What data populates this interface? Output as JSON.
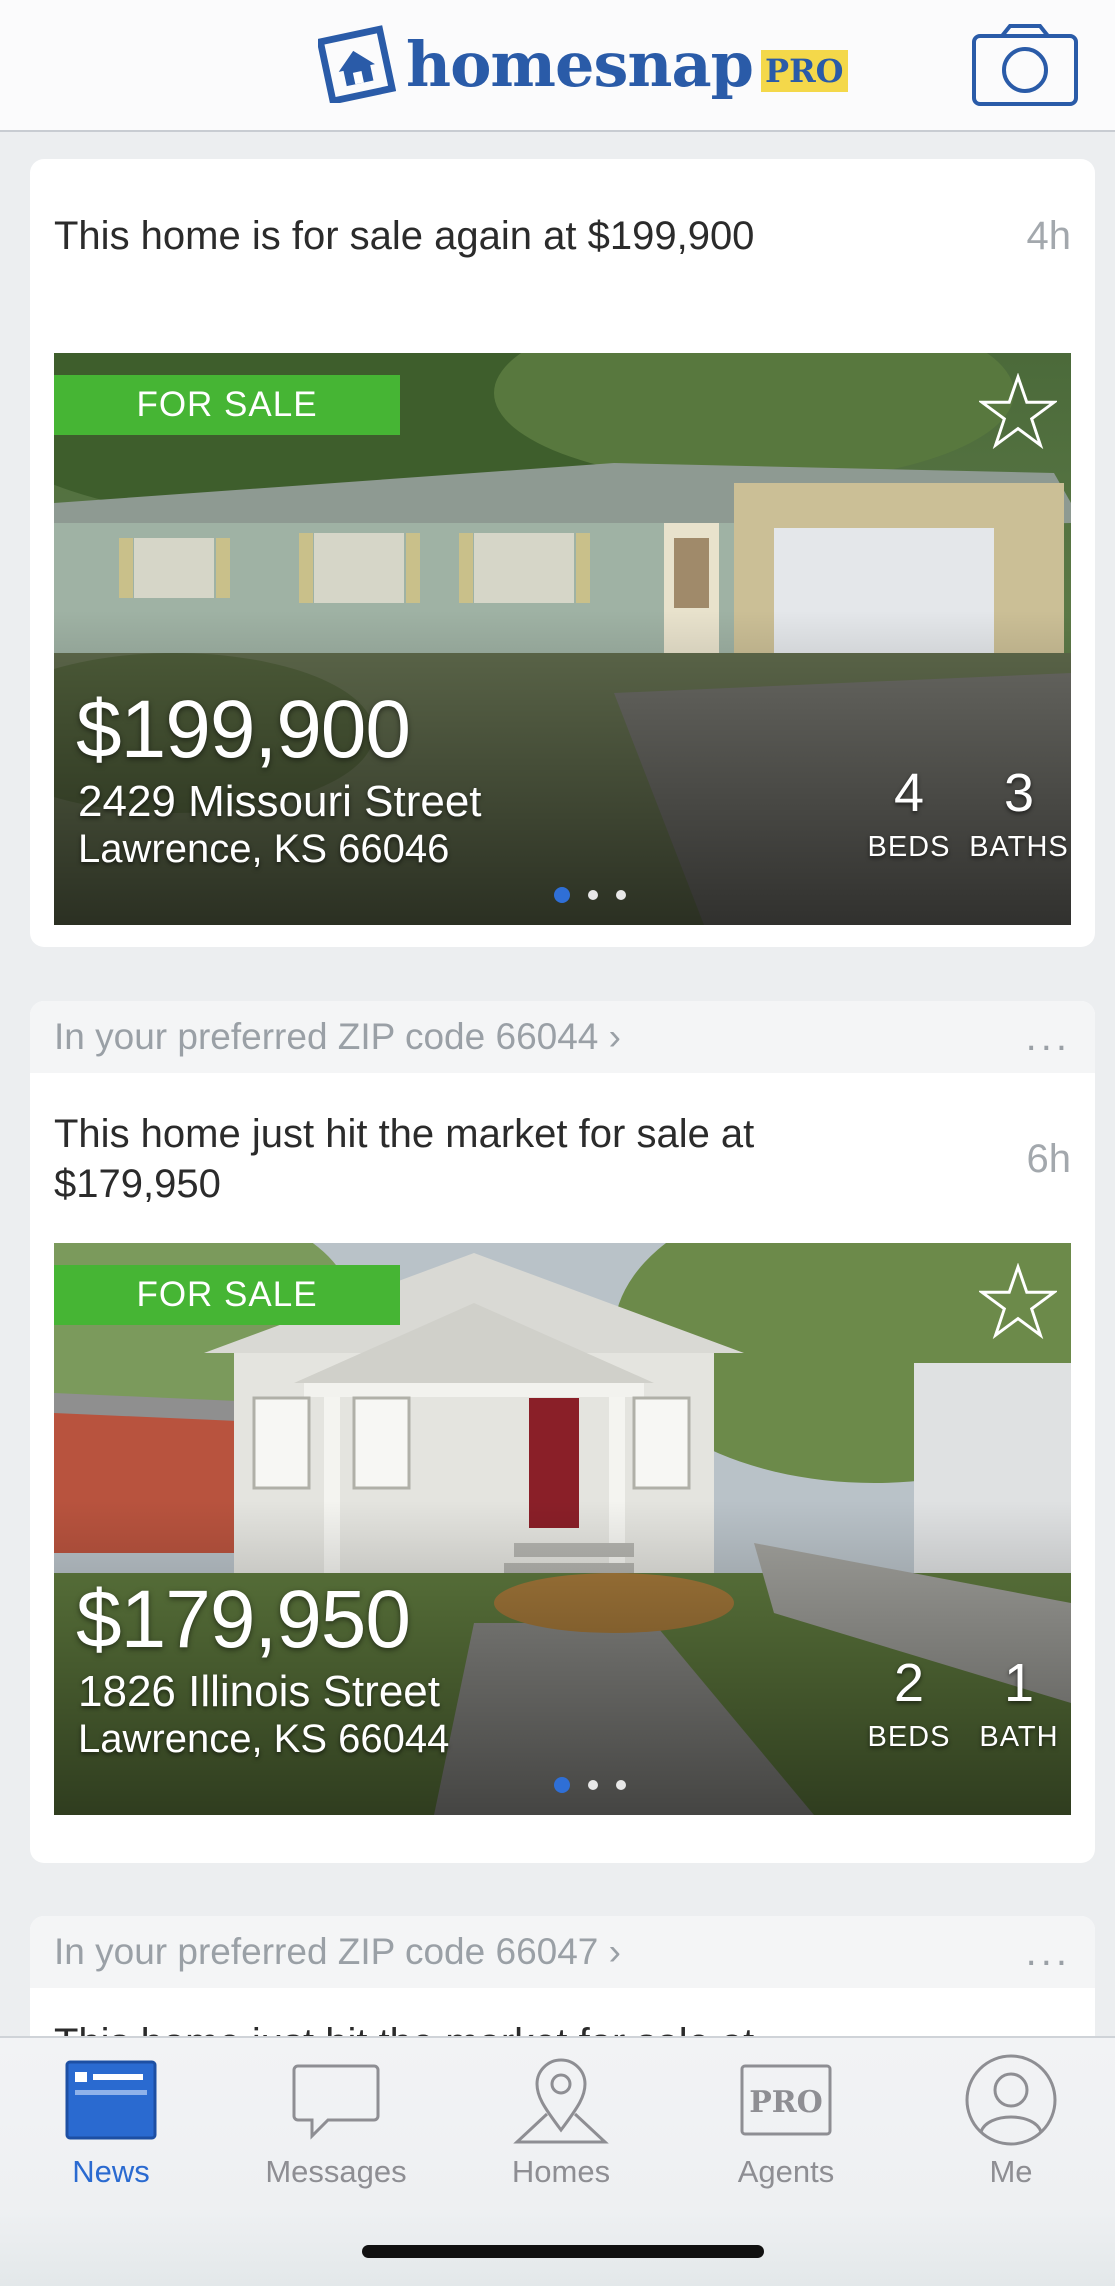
{
  "header": {
    "logo_text": "homesnap",
    "logo_badge": "PRO",
    "camera_icon": "camera-icon"
  },
  "feed": [
    {
      "context": null,
      "headline": "This home is for sale again at $199,900",
      "time": "4h",
      "badge": "FOR SALE",
      "price": "$199,900",
      "street": "2429 Missouri Street",
      "city": "Lawrence, KS 66046",
      "beds": "4",
      "beds_label": "BEDS",
      "baths": "3",
      "baths_label": "BATHS",
      "photo_index": 0,
      "photo_count": 3
    },
    {
      "context": "In your preferred ZIP code 66044 ›",
      "headline": "This home just hit the market for sale at $179,950",
      "time": "6h",
      "badge": "FOR SALE",
      "price": "$179,950",
      "street": "1826 Illinois Street",
      "city": "Lawrence, KS 66044",
      "beds": "2",
      "beds_label": "BEDS",
      "baths": "1",
      "baths_label": "BATH",
      "photo_index": 0,
      "photo_count": 3
    },
    {
      "context": "In your preferred ZIP code 66047 ›",
      "headline": "This home just hit the market for sale at"
    }
  ],
  "more_label": "...",
  "tabs": [
    {
      "label": "News",
      "icon": "news-icon",
      "active": true
    },
    {
      "label": "Messages",
      "icon": "messages-icon",
      "active": false
    },
    {
      "label": "Homes",
      "icon": "homes-pin-icon",
      "active": false
    },
    {
      "label": "Agents",
      "icon": "agents-pro-icon",
      "active": false
    },
    {
      "label": "Me",
      "icon": "profile-icon",
      "active": false
    }
  ],
  "colors": {
    "brand_blue": "#2a5ba8",
    "pro_yellow": "#f4d84a",
    "sale_green": "#46b534",
    "active_tab": "#2a6ad0",
    "inactive_tab": "#8e8e93"
  }
}
